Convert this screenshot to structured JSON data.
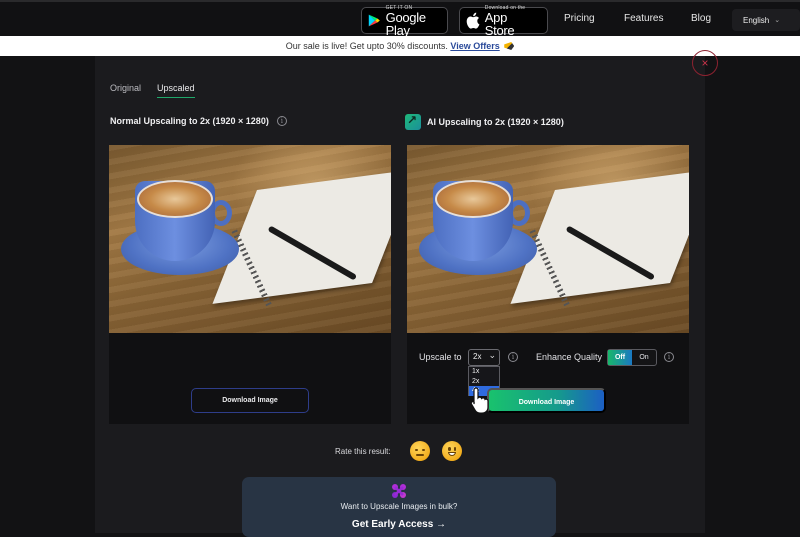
{
  "topbar": {
    "google_play": {
      "small": "GET IT ON",
      "big": "Google Play"
    },
    "app_store": {
      "small": "Download on the",
      "big": "App Store"
    },
    "nav": [
      {
        "label": "Pricing"
      },
      {
        "label": "Features"
      },
      {
        "label": "Blog"
      }
    ],
    "language": "English"
  },
  "promo": {
    "text": "Our sale is live! Get upto 30% discounts.",
    "link": "View Offers"
  },
  "modal": {
    "close_icon": "×",
    "tabs": [
      {
        "label": "Original",
        "active": false
      },
      {
        "label": "Upscaled",
        "active": true
      }
    ],
    "left": {
      "title": "Normal Upscaling to 2x (1920 × 1280)",
      "download_label": "Download Image"
    },
    "right": {
      "title": "AI Upscaling to 2x (1920 × 1280)",
      "upscale_label": "Upscale to",
      "upscale_value": "2x",
      "upscale_options": [
        "1x",
        "2x",
        "4x"
      ],
      "upscale_highlighted": "4x",
      "enhance_label": "Enhance Quality",
      "enhance_off": "Off",
      "enhance_on": "On",
      "enhance_selected": "Off",
      "download_label": "Download Image"
    },
    "rating": {
      "label": "Rate this result:"
    },
    "bulk": {
      "text": "Want to Upscale Images in bulk?",
      "cta": "Get Early Access →"
    }
  },
  "colors": {
    "accent_green": "#19c26d",
    "accent_blue": "#1c5fc4",
    "close_red": "#c8334a",
    "bulk_bg": "#283444"
  }
}
